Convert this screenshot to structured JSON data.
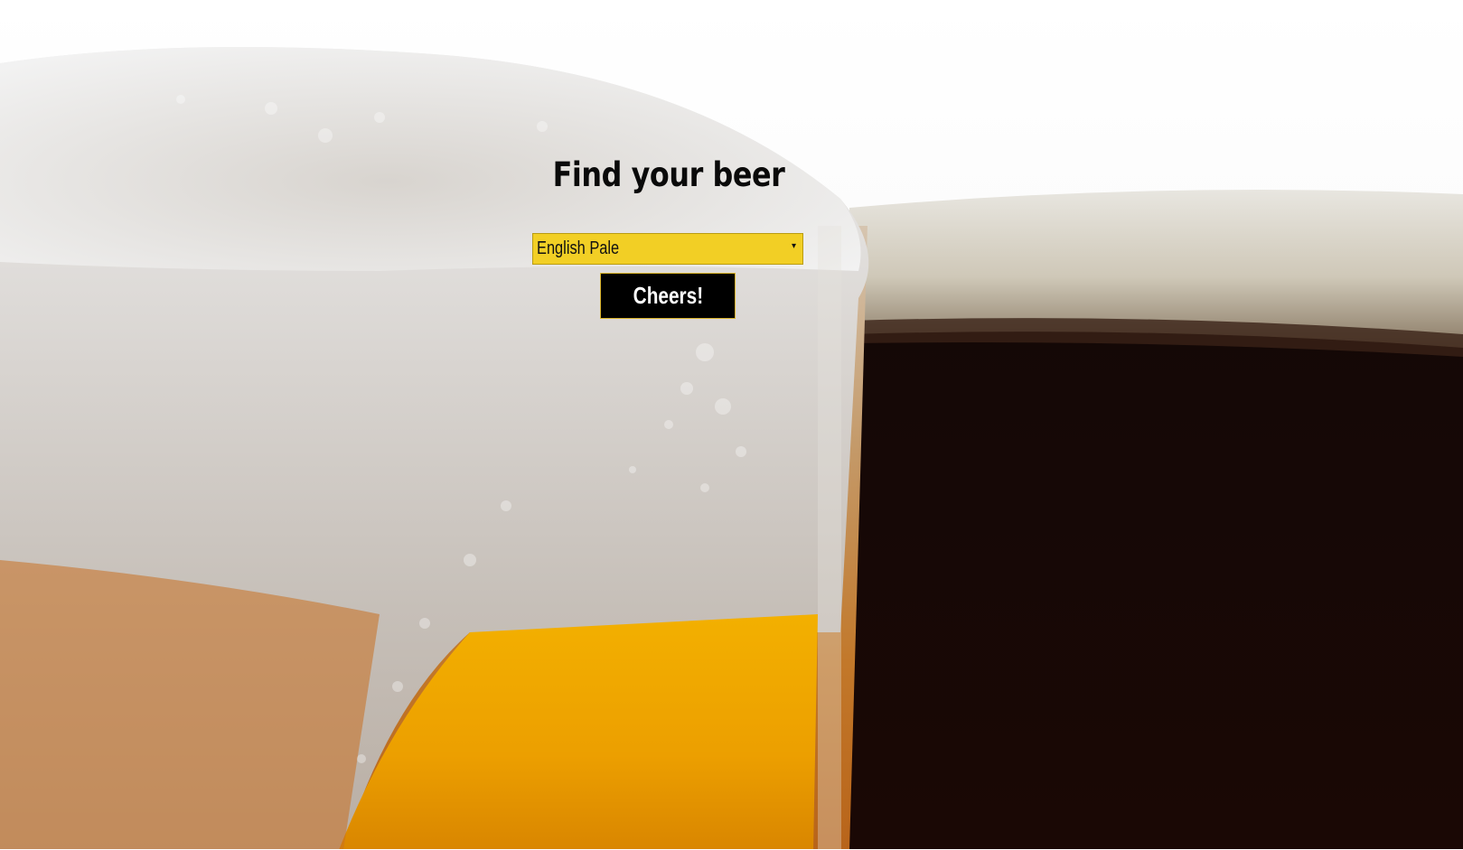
{
  "page": {
    "title": "Find your beer"
  },
  "beer_select": {
    "selected": "English Pale",
    "arrow_icon": "caret-down-icon"
  },
  "submit_button": {
    "label": "Cheers!"
  },
  "background": {
    "icon": "beer-glasses-photo"
  },
  "colors": {
    "select_fill": "#f2cf25",
    "button_fill": "#000000",
    "button_border": "#d9b32a",
    "title_text": "#0a0a0a"
  }
}
